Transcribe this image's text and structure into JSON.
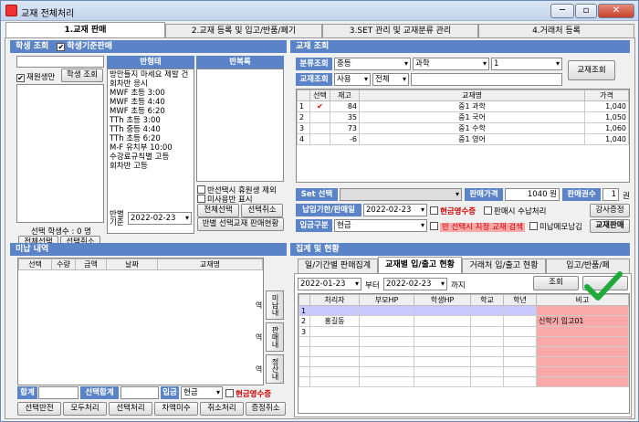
{
  "window": {
    "title": "교재 전체처리",
    "min": "─",
    "max": "▫",
    "close": "✕"
  },
  "tabs": [
    "1.교재 판매",
    "2.교재 등록 및 입고/반품/폐기",
    "3.SET 관리 및 교재분류 관리",
    "4.거래처 등록"
  ],
  "students": {
    "header": "학생 조회",
    "checkbox_label": "학생기준판매",
    "enrolled_only": "재원생만",
    "search_button": "학생 조회",
    "count_label": "선택 학생수 : 0 명",
    "select_all": "전체선택",
    "select_cancel": "선택취소"
  },
  "classes": {
    "header": "반형태",
    "items": [
      "방만들지 마세요 제발 건",
      "회차반 응시",
      "MWF 초등 3:00",
      "MWF 초등 4:40",
      "MWF 초등 6:20",
      "TTh 초등 3:00",
      "TTh 중등 4:40",
      "TTh 초등 6:20",
      "M-F 유치부 10:00",
      "수강료규칙별 고등",
      "회차반 고등"
    ]
  },
  "repeats": {
    "header": "반복록",
    "exclude_label": "반선택시 휴원생 제외",
    "show_unpaid": "미사용반 표시",
    "select_all": "전체선택",
    "select_cancel": "선택취소",
    "date_label_top": "반별",
    "date_label_bottom": "기준",
    "date": "2022-02-23",
    "sales_button": "반별 선택교재 판매현황"
  },
  "textbook": {
    "header": "교재 조회",
    "category_label": "분류조회",
    "category1": "중등",
    "category2": "과학",
    "category3": "1",
    "search_button": "교재조회",
    "lookup_label": "교재조회",
    "lookup1": "사용",
    "lookup2": "전체",
    "columns": [
      "",
      "선택",
      "재고",
      "교재명",
      "가격"
    ],
    "rows": [
      [
        "1",
        "✔",
        "84",
        "중1 과학",
        "1,040"
      ],
      [
        "2",
        "",
        "35",
        "중1 국어",
        "1,050"
      ],
      [
        "3",
        "",
        "73",
        "중1 수학",
        "1,060"
      ],
      [
        "4",
        "",
        "-6",
        "중1 영어",
        "1,040"
      ]
    ],
    "set_label": "Set 선택",
    "sale_price_label": "판매가격",
    "sale_price": "1040 원",
    "sale_qty_label": "판매권수",
    "sale_qty": "1",
    "qty_unit": "권",
    "pay_date_label": "납입기한/판매일",
    "pay_date": "2022-02-23",
    "cash_receipt": "현금영수증",
    "sale_receipt": "판매시 수납처리",
    "textbook_check_button": "강사증정",
    "pay_type_label": "입금구분",
    "pay_type": "현금",
    "class_select_note": "반 선택시 지정 교재 검색",
    "unpaid_note": "미납메모남김",
    "sell_button": "교재판매"
  },
  "unpaid": {
    "header": "미납 내역",
    "columns": [
      "선택",
      "수량",
      "금액",
      "날짜",
      "교재명"
    ],
    "side_buttons": [
      "미납내역",
      "판매내역",
      "정산내역"
    ],
    "total_label": "합계",
    "select_total_label": "선택합계",
    "deposit_label": "입금",
    "deposit_type": "현금",
    "cash_receipt": "현금영수증",
    "buttons": [
      "선택반전",
      "모두처리",
      "선택처리",
      "차액미수",
      "취소처리",
      "증정취소"
    ]
  },
  "stats": {
    "header": "집계 및 현황",
    "tabs": [
      "일/기간별 판매집계",
      "교재별 입/출고 현황",
      "거래처 입/출고 현황",
      "입고/반품/폐"
    ],
    "date_from": "2022-01-23",
    "from_label": "부터",
    "date_to": "2022-02-23",
    "to_label": "까지",
    "search_button": "조회",
    "columns": [
      "",
      "처리자",
      "부모HP",
      "학생HP",
      "학교",
      "학년",
      "비고"
    ],
    "rows": [
      [
        "1",
        "",
        "",
        "",
        "",
        "",
        ""
      ],
      [
        "2",
        "홍길동",
        "",
        "",
        "",
        "",
        "신학기 입고01"
      ],
      [
        "3",
        "",
        "",
        "",
        "",
        "",
        ""
      ]
    ]
  }
}
